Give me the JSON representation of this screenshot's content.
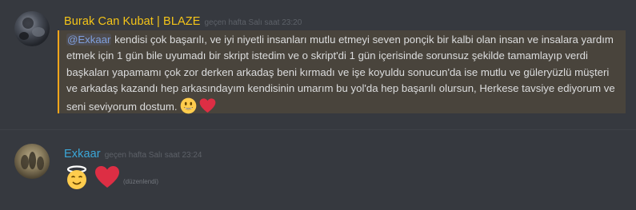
{
  "messages": [
    {
      "username": "Burak Can Kubat | BLAZE",
      "timestamp": "geçen hafta Salı saat 23:20",
      "mention": "@Exkaar",
      "text": " kendisi çok başarılı, ve iyi niyetli insanları mutlu etmeyi seven ponçik bir kalbi olan insan ve insalara yardım etmek için 1 gün bile uyumadı bir skript istedim ve o skript'di 1 gün içerisinde sorunsuz şekilde tamamlayıp verdi başkaları yapamamı çok zor derken arkadaş beni kırmadı ve işe koyuldu sonucun'da ise mutlu ve güleryüzlü müşteri ve arkadaş kazandı hep arkasındayım kendisinin umarım bu yol'da hep başarılı olursun, Herkese tavsiye ediyorum ve seni seviyorum dostum.",
      "emojis": [
        "smiley-icon",
        "heart-icon"
      ],
      "colors": {
        "username": "#f5c518",
        "highlight": "#49443c",
        "highlight_border": "#faa61a"
      }
    },
    {
      "username": "Exkaar",
      "timestamp": "geçen hafta Salı saat 23:24",
      "emojis": [
        "innocent-face-icon",
        "heart-icon"
      ],
      "edited_label": "(düzenlendi)",
      "colors": {
        "username": "#3ba7d8"
      }
    }
  ],
  "colors": {
    "background": "#36393f",
    "text": "#dcddde",
    "mention": "#7f9fdc",
    "timestamp": "#5d6168"
  }
}
